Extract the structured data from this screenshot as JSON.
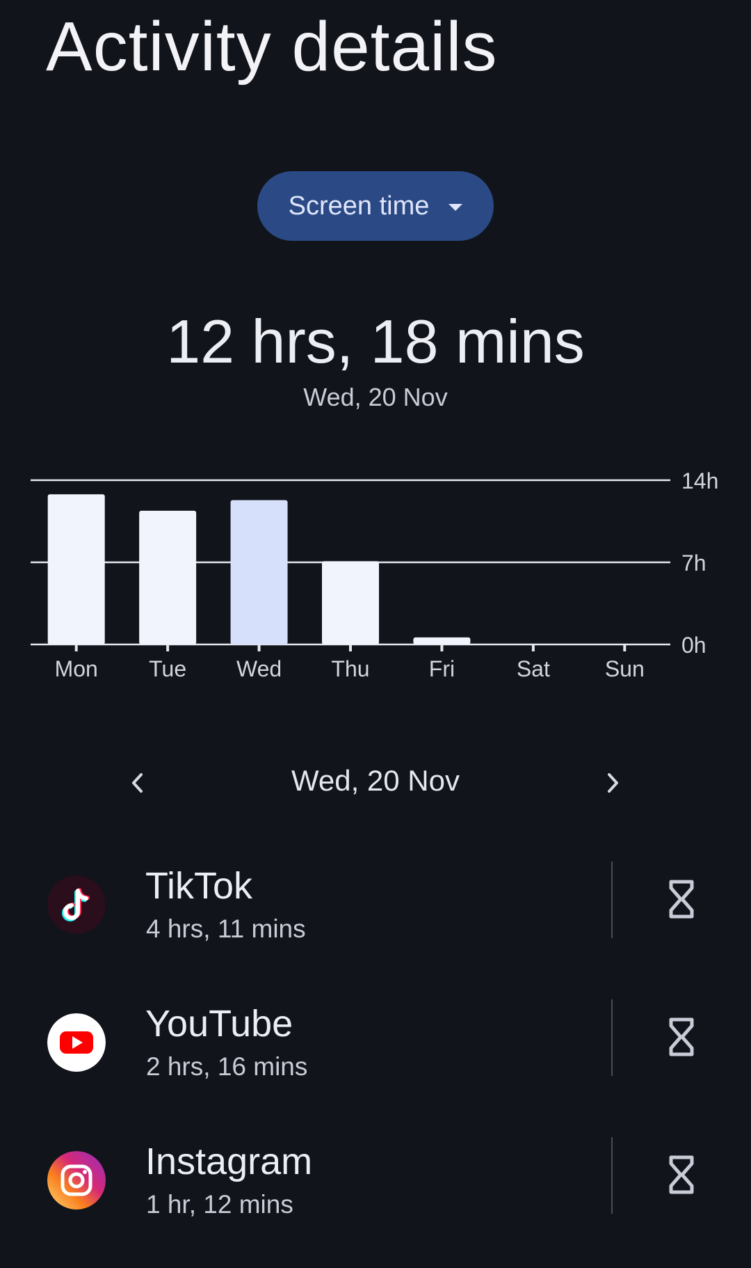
{
  "header": {
    "title": "Activity details"
  },
  "metric_selector": {
    "label": "Screen time",
    "icon": "dropdown-arrow-icon"
  },
  "summary": {
    "total": "12 hrs, 18 mins",
    "date": "Wed, 20 Nov"
  },
  "chart_data": {
    "type": "bar",
    "categories": [
      "Mon",
      "Tue",
      "Wed",
      "Thu",
      "Fri",
      "Sat",
      "Sun"
    ],
    "values": [
      12.8,
      11.4,
      12.3,
      7.1,
      0.6,
      0,
      0
    ],
    "selected_index": 2,
    "ylim": [
      0,
      14
    ],
    "y_ticks": [
      "0h",
      "7h",
      "14h"
    ],
    "axis_position": "right",
    "grid": true,
    "colors": {
      "bar": "#f2f4fd",
      "bar_selected": "#d6e0fb",
      "grid": "#e6e8ee",
      "tick_label": "#d3d5de"
    }
  },
  "day_nav": {
    "prev_icon": "chevron-left-icon",
    "next_icon": "chevron-right-icon",
    "date": "Wed, 20 Nov"
  },
  "apps": [
    {
      "name": "TikTok",
      "time": "4 hrs, 11 mins",
      "icon": "tiktok-icon",
      "action_icon": "hourglass-icon"
    },
    {
      "name": "YouTube",
      "time": "2 hrs, 16 mins",
      "icon": "youtube-icon",
      "action_icon": "hourglass-icon"
    },
    {
      "name": "Instagram",
      "time": "1 hr, 12 mins",
      "icon": "instagram-icon",
      "action_icon": "hourglass-icon"
    }
  ],
  "colors": {
    "background": "#11141b",
    "accent_pill": "#2b4a85",
    "primary_text": "#eceef4",
    "secondary_text": "#c9ccd6"
  }
}
